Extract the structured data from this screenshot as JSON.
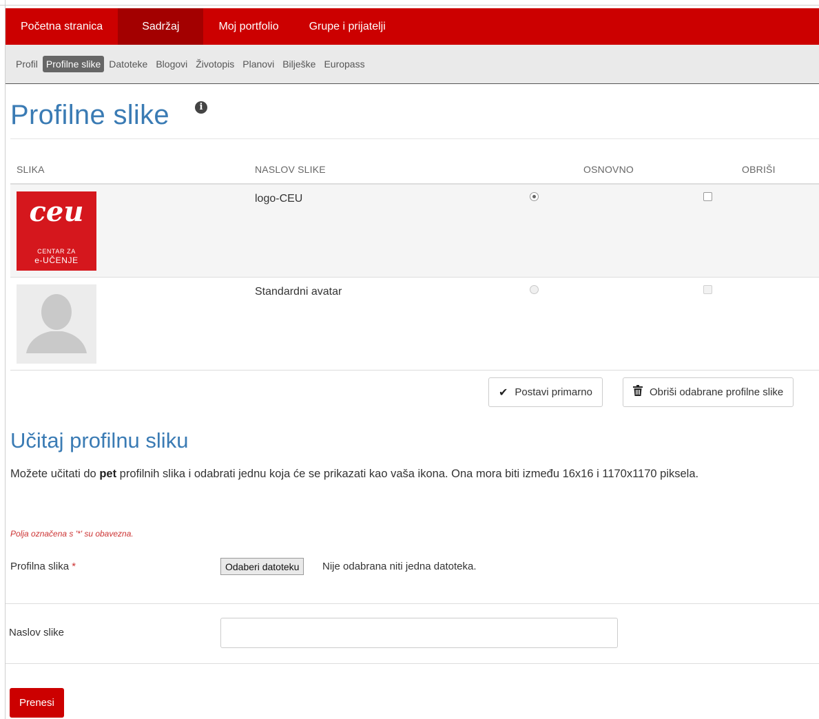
{
  "nav": {
    "items": [
      "Početna stranica",
      "Sadržaj",
      "Moj portfolio",
      "Grupe i prijatelji"
    ],
    "active_index": 1
  },
  "subnav": {
    "items": [
      "Profil",
      "Profilne slike",
      "Datoteke",
      "Blogovi",
      "Životopis",
      "Planovi",
      "Bilješke",
      "Europass"
    ],
    "active_index": 1
  },
  "page": {
    "title": "Profilne slike",
    "info_icon": "info-circle-icon"
  },
  "table": {
    "headers": {
      "image": "SLIKA",
      "title": "NASLOV SLIKE",
      "default": "OSNOVNO",
      "delete": "OBRIŠI"
    },
    "rows": [
      {
        "title": "logo-CEU",
        "image": "ceu-logo",
        "logo_line1": "CENTAR ZA",
        "logo_line2": "e-UČENJE",
        "is_default": true,
        "delete_enabled": true
      },
      {
        "title": "Standardni avatar",
        "image": "default-avatar",
        "is_default": false,
        "delete_enabled": false
      }
    ]
  },
  "actions": {
    "set_primary": "Postavi primarno",
    "delete_selected": "Obriši odabrane profilne slike"
  },
  "upload": {
    "heading": "Učitaj profilnu sliku",
    "desc_before": "Možete učitati do ",
    "desc_bold": "pet",
    "desc_after": " profilnih slika i odabrati jednu koja će se prikazati kao vaša ikona. Ona mora biti između 16x16 i 1170x1170 piksela.",
    "required_note": "Polja označena s '*' su obavezna.",
    "file_label": "Profilna slika",
    "required_mark": "*",
    "file_button": "Odaberi datoteku",
    "file_status": "Nije odabrana niti jedna datoteka.",
    "title_label": "Naslov slike",
    "title_value": "",
    "submit": "Prenesi"
  },
  "colors": {
    "brand_red": "#cc0000",
    "active_red": "#a30000",
    "heading_blue": "#3a7bb4"
  }
}
